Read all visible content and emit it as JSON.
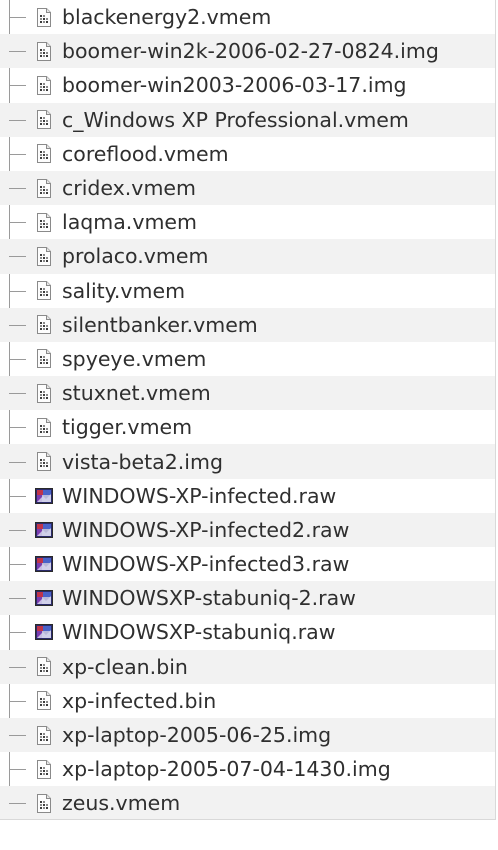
{
  "file_tree": {
    "items": [
      {
        "name": "blackenergy2.vmem",
        "icon": "generic-file-icon"
      },
      {
        "name": "boomer-win2k-2006-02-27-0824.img",
        "icon": "generic-file-icon"
      },
      {
        "name": "boomer-win2003-2006-03-17.img",
        "icon": "generic-file-icon"
      },
      {
        "name": "c_Windows XP Professional.vmem",
        "icon": "generic-file-icon"
      },
      {
        "name": "coreflood.vmem",
        "icon": "generic-file-icon"
      },
      {
        "name": "cridex.vmem",
        "icon": "generic-file-icon"
      },
      {
        "name": "laqma.vmem",
        "icon": "generic-file-icon"
      },
      {
        "name": "prolaco.vmem",
        "icon": "generic-file-icon"
      },
      {
        "name": "sality.vmem",
        "icon": "generic-file-icon"
      },
      {
        "name": "silentbanker.vmem",
        "icon": "generic-file-icon"
      },
      {
        "name": "spyeye.vmem",
        "icon": "generic-file-icon"
      },
      {
        "name": "stuxnet.vmem",
        "icon": "generic-file-icon"
      },
      {
        "name": "tigger.vmem",
        "icon": "generic-file-icon"
      },
      {
        "name": "vista-beta2.img",
        "icon": "generic-file-icon"
      },
      {
        "name": "WINDOWS-XP-infected.raw",
        "icon": "image-file-icon"
      },
      {
        "name": "WINDOWS-XP-infected2.raw",
        "icon": "image-file-icon"
      },
      {
        "name": "WINDOWS-XP-infected3.raw",
        "icon": "image-file-icon"
      },
      {
        "name": "WINDOWSXP-stabuniq-2.raw",
        "icon": "image-file-icon"
      },
      {
        "name": "WINDOWSXP-stabuniq.raw",
        "icon": "image-file-icon"
      },
      {
        "name": "xp-clean.bin",
        "icon": "generic-file-icon"
      },
      {
        "name": "xp-infected.bin",
        "icon": "generic-file-icon"
      },
      {
        "name": "xp-laptop-2005-06-25.img",
        "icon": "generic-file-icon"
      },
      {
        "name": "xp-laptop-2005-07-04-1430.img",
        "icon": "generic-file-icon"
      },
      {
        "name": "zeus.vmem",
        "icon": "generic-file-icon"
      }
    ]
  }
}
